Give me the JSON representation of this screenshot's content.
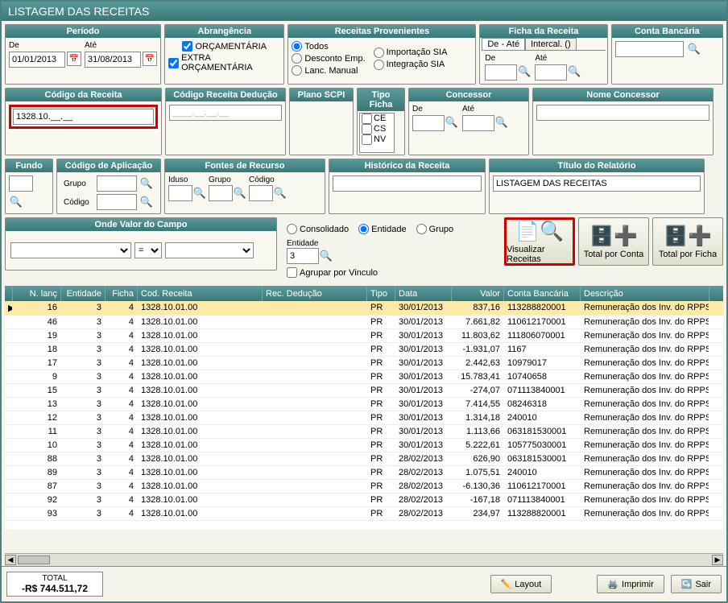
{
  "window_title": "LISTAGEM DAS RECEITAS",
  "periodo": {
    "title": "Período",
    "de_label": "De",
    "ate_label": "Até",
    "de": "01/01/2013",
    "ate": "31/08/2013"
  },
  "abrangencia": {
    "title": "Abrangência",
    "opt1": "ORÇAMENTÁRIA",
    "opt2": "EXTRA ORÇAMENTÁRIA"
  },
  "recprov": {
    "title": "Receitas Provenientes",
    "todos": "Todos",
    "desc": "Desconto Emp.",
    "lanc": "Lanc. Manual",
    "imp": "Importação SIA",
    "integ": "Integração SIA"
  },
  "ficha": {
    "title": "Ficha da Receita",
    "tab1": "De - Até",
    "tab2": "Intercal. ()",
    "de_label": "De",
    "ate_label": "Até"
  },
  "contab": {
    "title": "Conta Bancária"
  },
  "codrec": {
    "title": "Código da Receita",
    "value": "1328.10.__.__"
  },
  "codded": {
    "title": "Código Receita Dedução",
    "value": "____.__.__.__"
  },
  "plano": {
    "title": "Plano SCPI"
  },
  "tipoficha": {
    "title": "Tipo Ficha",
    "items": [
      "CE",
      "CS",
      "NV"
    ]
  },
  "concessor": {
    "title": "Concessor",
    "de_label": "De",
    "ate_label": "Até"
  },
  "nomeconc": {
    "title": "Nome Concessor"
  },
  "fundo": {
    "title": "Fundo"
  },
  "codapp": {
    "title": "Código de Aplicação",
    "grupo": "Grupo",
    "codigo": "Código"
  },
  "fontes": {
    "title": "Fontes de Recurso",
    "iduso": "Iduso",
    "grupo": "Grupo",
    "codigo": "Código"
  },
  "historico": {
    "title": "Histórico da Receita"
  },
  "titulorel": {
    "title": "Título do Relatório",
    "value": "LISTAGEM DAS RECEITAS"
  },
  "onde": {
    "title": "Onde Valor do Campo",
    "op": "="
  },
  "grouping": {
    "consolidado": "Consolidado",
    "entidade": "Entidade",
    "grupo": "Grupo",
    "entidade_label": "Entidade",
    "entidade_val": "3",
    "agrupar": "Agrupar por Vinculo"
  },
  "buttons": {
    "visualizar": "Visualizar Receitas",
    "totalconta": "Total por Conta",
    "totalficha": "Total por Ficha",
    "layout": "Layout",
    "imprimir": "Imprimir",
    "sair": "Sair"
  },
  "total": {
    "label": "TOTAL",
    "value": "-R$ 744.511,72"
  },
  "grid": {
    "headers": [
      "N. lanç",
      "Entidade",
      "Ficha",
      "Cod. Receita",
      "Rec. Dedução",
      "Tipo",
      "Data",
      "Valor",
      "Conta Bancária",
      "Descrição"
    ],
    "rows": [
      {
        "nl": "16",
        "ent": "3",
        "fic": "4",
        "cod": "1328.10.01.00",
        "ded": "",
        "tip": "PR",
        "dat": "30/01/2013",
        "val": "837,16",
        "cb": "113288820001",
        "des": "Remuneração dos Inv. do RPPS em Ren"
      },
      {
        "nl": "46",
        "ent": "3",
        "fic": "4",
        "cod": "1328.10.01.00",
        "ded": "",
        "tip": "PR",
        "dat": "30/01/2013",
        "val": "7.661,82",
        "cb": "110612170001",
        "des": "Remuneração dos Inv. do RPPS em Ren"
      },
      {
        "nl": "19",
        "ent": "3",
        "fic": "4",
        "cod": "1328.10.01.00",
        "ded": "",
        "tip": "PR",
        "dat": "30/01/2013",
        "val": "11.803,62",
        "cb": "111806070001",
        "des": "Remuneração dos Inv. do RPPS em Ren"
      },
      {
        "nl": "18",
        "ent": "3",
        "fic": "4",
        "cod": "1328.10.01.00",
        "ded": "",
        "tip": "PR",
        "dat": "30/01/2013",
        "val": "-1.931,07",
        "cb": "1167",
        "des": "Remuneração dos Inv. do RPPS em Ren"
      },
      {
        "nl": "17",
        "ent": "3",
        "fic": "4",
        "cod": "1328.10.01.00",
        "ded": "",
        "tip": "PR",
        "dat": "30/01/2013",
        "val": "2.442,63",
        "cb": "10979017",
        "des": "Remuneração dos Inv. do RPPS em Ren"
      },
      {
        "nl": "9",
        "ent": "3",
        "fic": "4",
        "cod": "1328.10.01.00",
        "ded": "",
        "tip": "PR",
        "dat": "30/01/2013",
        "val": "15.783,41",
        "cb": "10740658",
        "des": "Remuneração dos Inv. do RPPS em Ren"
      },
      {
        "nl": "15",
        "ent": "3",
        "fic": "4",
        "cod": "1328.10.01.00",
        "ded": "",
        "tip": "PR",
        "dat": "30/01/2013",
        "val": "-274,07",
        "cb": "071113840001",
        "des": "Remuneração dos Inv. do RPPS em Ren"
      },
      {
        "nl": "13",
        "ent": "3",
        "fic": "4",
        "cod": "1328.10.01.00",
        "ded": "",
        "tip": "PR",
        "dat": "30/01/2013",
        "val": "7.414,55",
        "cb": "08246318",
        "des": "Remuneração dos Inv. do RPPS em Ren"
      },
      {
        "nl": "12",
        "ent": "3",
        "fic": "4",
        "cod": "1328.10.01.00",
        "ded": "",
        "tip": "PR",
        "dat": "30/01/2013",
        "val": "1.314,18",
        "cb": "240010",
        "des": "Remuneração dos Inv. do RPPS em Ren"
      },
      {
        "nl": "11",
        "ent": "3",
        "fic": "4",
        "cod": "1328.10.01.00",
        "ded": "",
        "tip": "PR",
        "dat": "30/01/2013",
        "val": "1.113,66",
        "cb": "063181530001",
        "des": "Remuneração dos Inv. do RPPS em Ren"
      },
      {
        "nl": "10",
        "ent": "3",
        "fic": "4",
        "cod": "1328.10.01.00",
        "ded": "",
        "tip": "PR",
        "dat": "30/01/2013",
        "val": "5.222,61",
        "cb": "105775030001",
        "des": "Remuneração dos Inv. do RPPS em Ren"
      },
      {
        "nl": "88",
        "ent": "3",
        "fic": "4",
        "cod": "1328.10.01.00",
        "ded": "",
        "tip": "PR",
        "dat": "28/02/2013",
        "val": "626,90",
        "cb": "063181530001",
        "des": "Remuneração dos Inv. do RPPS em Ren"
      },
      {
        "nl": "89",
        "ent": "3",
        "fic": "4",
        "cod": "1328.10.01.00",
        "ded": "",
        "tip": "PR",
        "dat": "28/02/2013",
        "val": "1.075,51",
        "cb": "240010",
        "des": "Remuneração dos Inv. do RPPS em Ren"
      },
      {
        "nl": "87",
        "ent": "3",
        "fic": "4",
        "cod": "1328.10.01.00",
        "ded": "",
        "tip": "PR",
        "dat": "28/02/2013",
        "val": "-6.130,36",
        "cb": "110612170001",
        "des": "Remuneração dos Inv. do RPPS em Ren"
      },
      {
        "nl": "92",
        "ent": "3",
        "fic": "4",
        "cod": "1328.10.01.00",
        "ded": "",
        "tip": "PR",
        "dat": "28/02/2013",
        "val": "-167,18",
        "cb": "071113840001",
        "des": "Remuneração dos Inv. do RPPS em Ren"
      },
      {
        "nl": "93",
        "ent": "3",
        "fic": "4",
        "cod": "1328.10.01.00",
        "ded": "",
        "tip": "PR",
        "dat": "28/02/2013",
        "val": "234,97",
        "cb": "113288820001",
        "des": "Remuneração dos Inv. do RPPS em Ren"
      }
    ]
  }
}
